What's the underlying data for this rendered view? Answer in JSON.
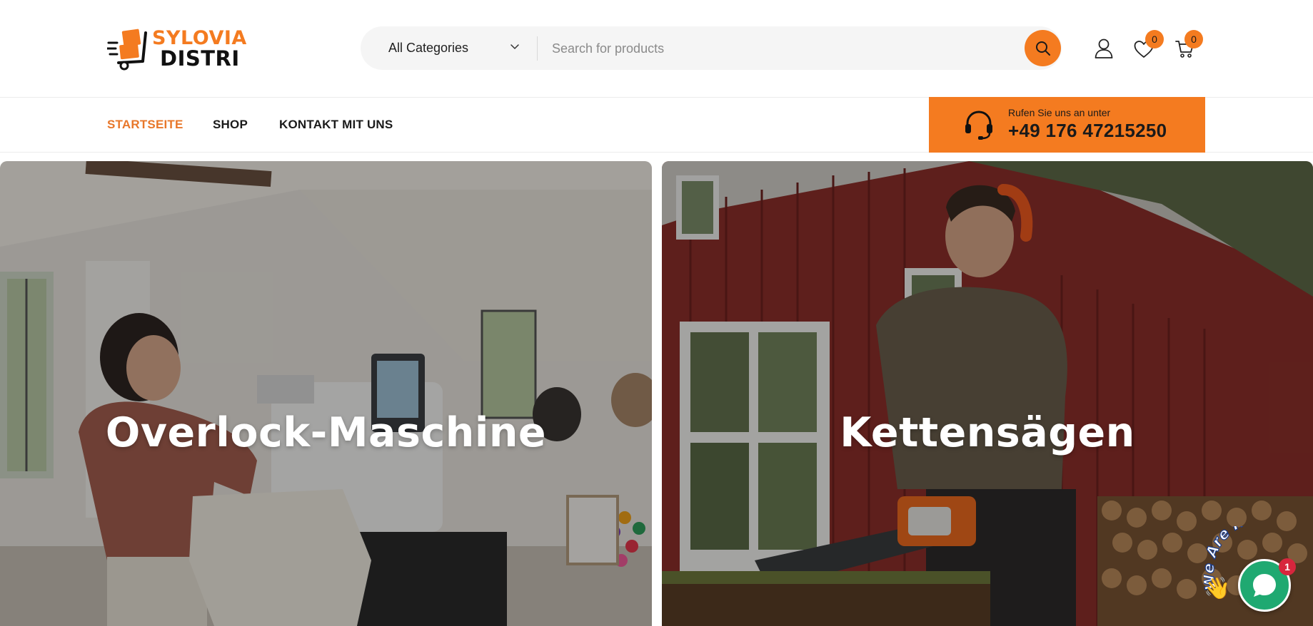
{
  "brand": {
    "logo_line1": "SYLOVIA",
    "logo_line2": "DISTRI",
    "accent_color": "#f47b20"
  },
  "search": {
    "category_label": "All Categories",
    "placeholder": "Search for products",
    "icon": "search-icon"
  },
  "header_icons": {
    "user": "user-icon",
    "wishlist": "heart-icon",
    "wishlist_count": "0",
    "cart": "cart-icon",
    "cart_count": "0"
  },
  "nav": {
    "items": [
      {
        "label": "STARTSEITE",
        "active": true
      },
      {
        "label": "SHOP",
        "active": false
      },
      {
        "label": "KONTAKT MIT UNS",
        "active": false
      }
    ]
  },
  "call": {
    "icon": "headset-icon",
    "label": "Rufen Sie uns an unter",
    "phone": "+49 176 47215250"
  },
  "banners": [
    {
      "title": "Overlock-Maschine"
    },
    {
      "title": "Kettensägen"
    }
  ],
  "chat": {
    "text": "We Are Here!",
    "unread": "1",
    "icon": "chat-bubble-icon",
    "color": "#1fa971"
  }
}
